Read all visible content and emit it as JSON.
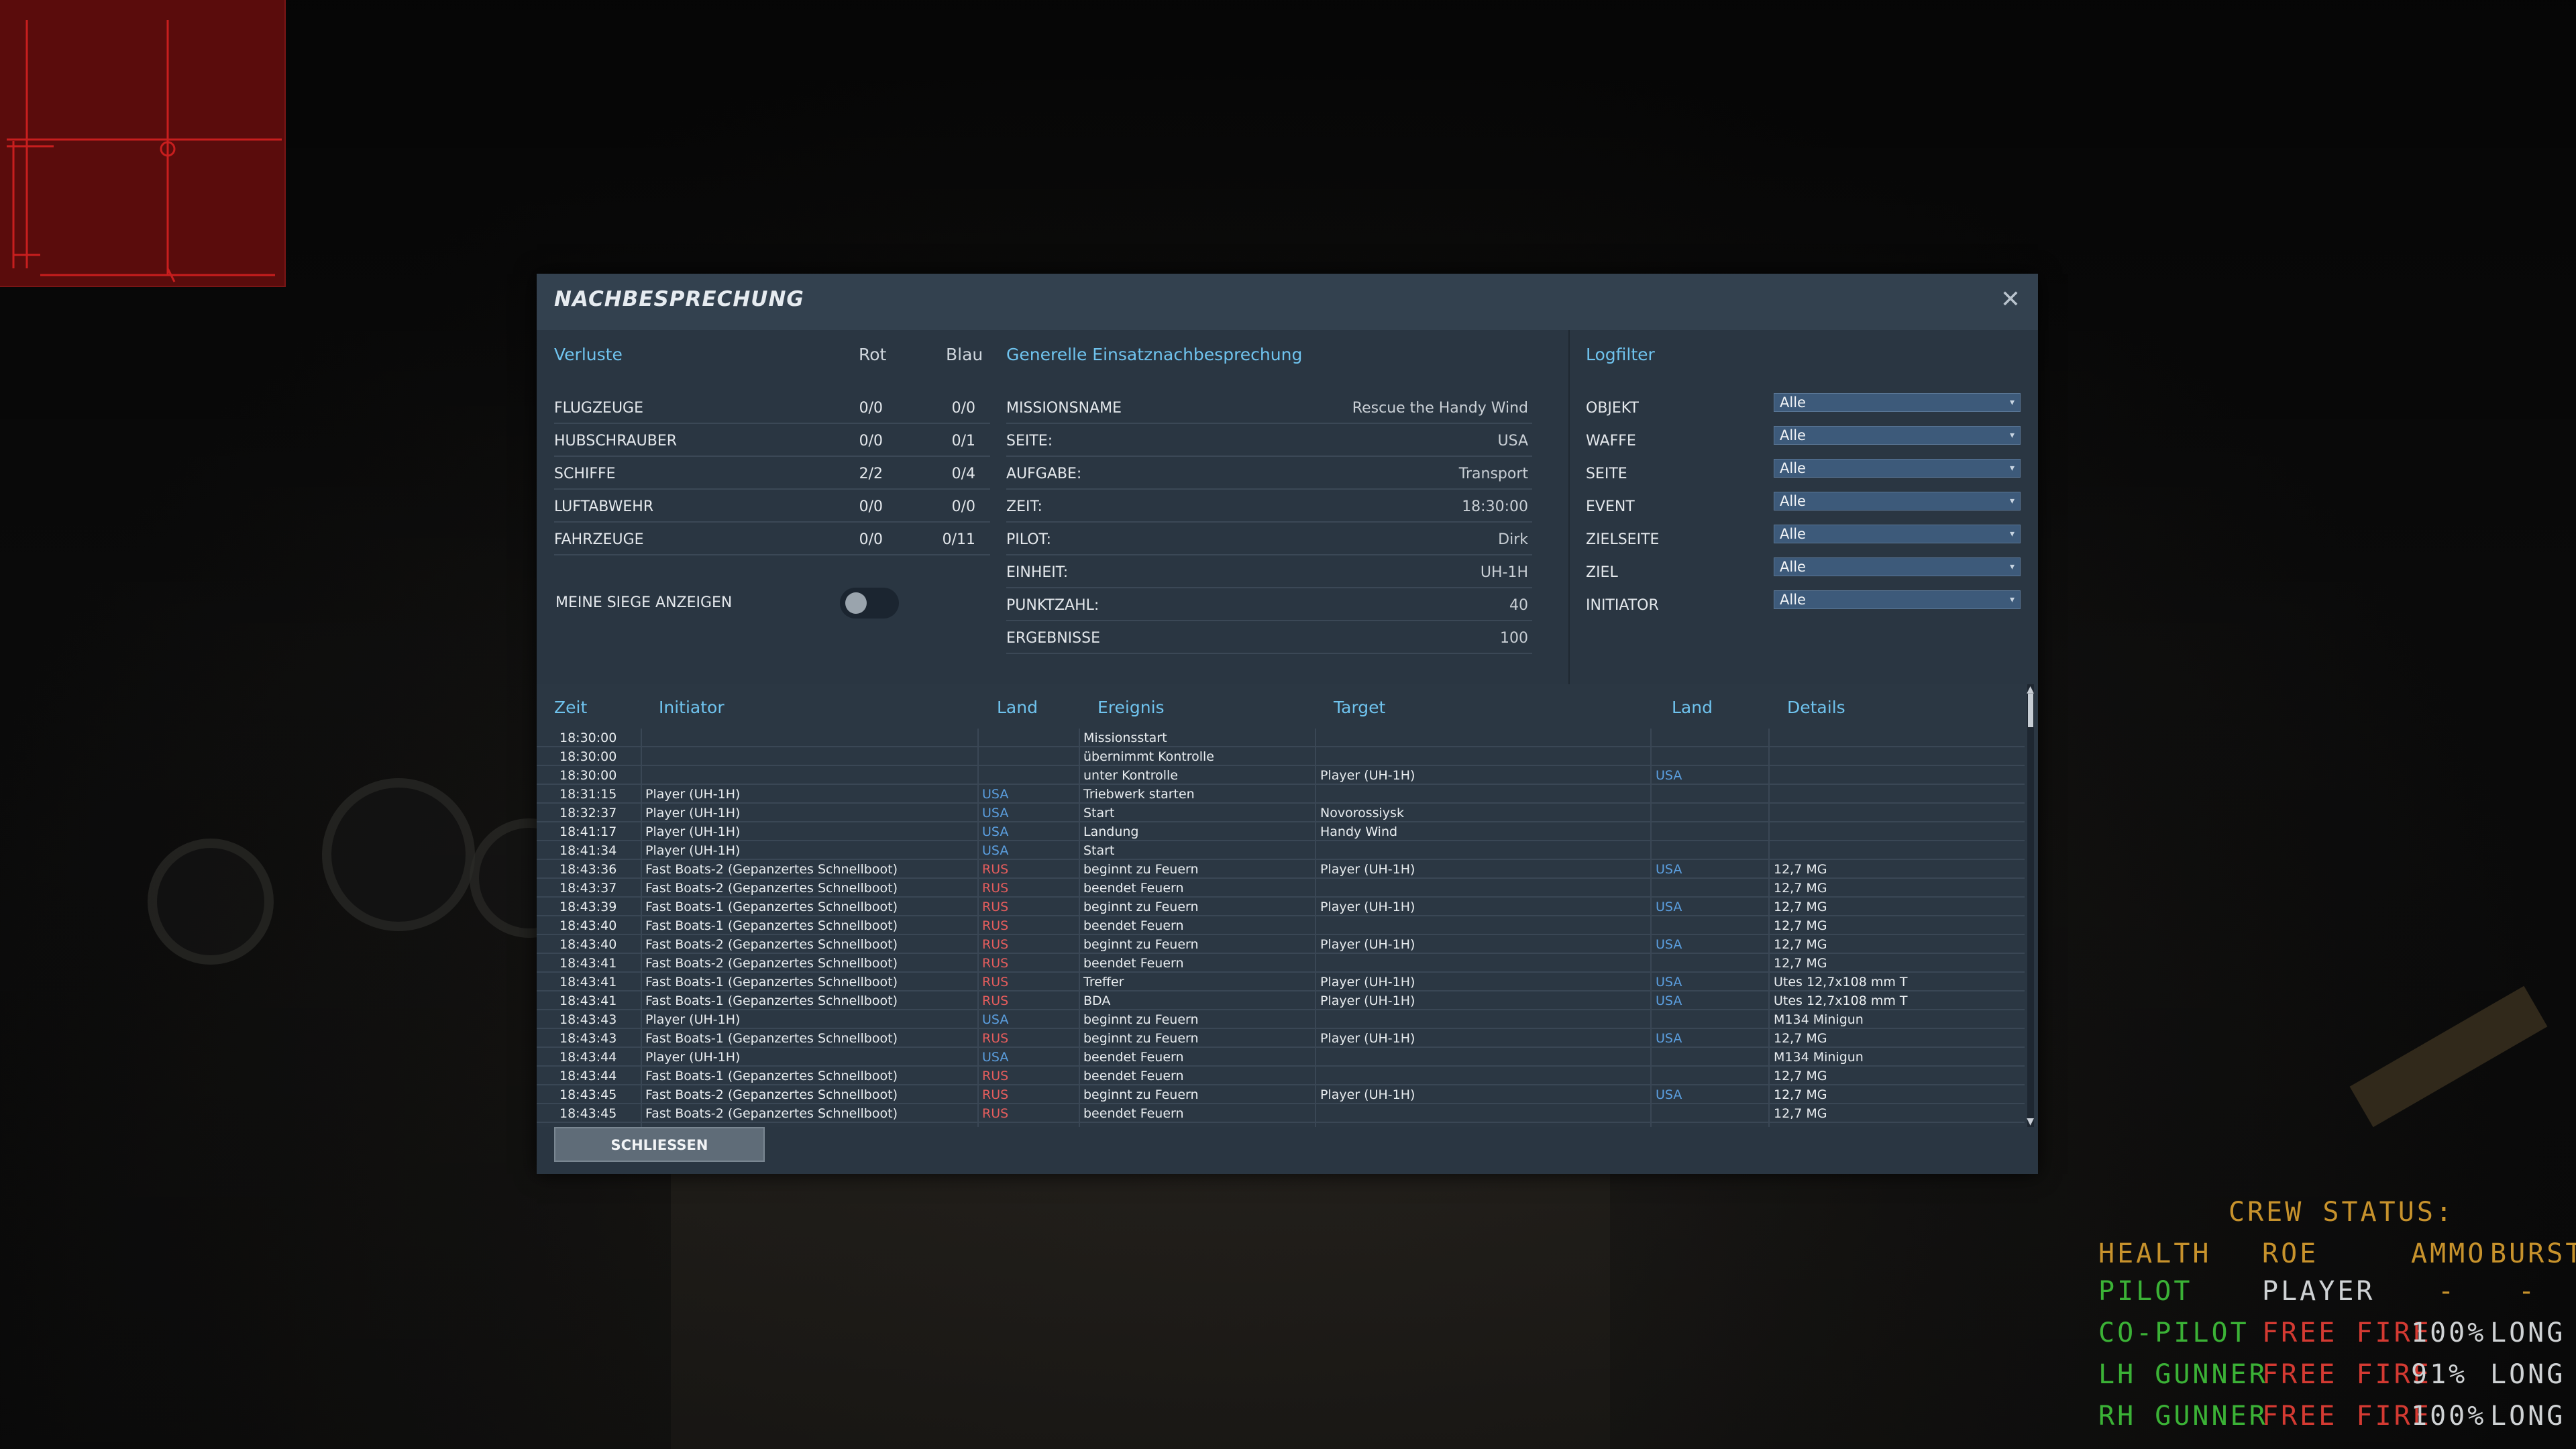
{
  "dialog": {
    "title": "NACHBESPRECHUNG",
    "close_icon": "close-icon",
    "close_button": "SCHLIESSEN"
  },
  "losses": {
    "header": "Verluste",
    "col_red": "Rot",
    "col_blue": "Blau",
    "rows": [
      {
        "label": "FLUGZEUGE",
        "red": "0/0",
        "blue": "0/0"
      },
      {
        "label": "HUBSCHRAUBER",
        "red": "0/0",
        "blue": "0/1"
      },
      {
        "label": "SCHIFFE",
        "red": "2/2",
        "blue": "0/4"
      },
      {
        "label": "LUFTABWEHR",
        "red": "0/0",
        "blue": "0/0"
      },
      {
        "label": "FAHRZEUGE",
        "red": "0/0",
        "blue": "0/11"
      }
    ],
    "toggle_label": "MEINE SIEGE ANZEIGEN",
    "toggle_on": false
  },
  "general": {
    "header": "Generelle Einsatznachbesprechung",
    "rows": [
      {
        "label": "MISSIONSNAME",
        "value": "Rescue the Handy Wind"
      },
      {
        "label": "SEITE:",
        "value": "USA"
      },
      {
        "label": "AUFGABE:",
        "value": "Transport"
      },
      {
        "label": "ZEIT:",
        "value": "18:30:00"
      },
      {
        "label": "PILOT:",
        "value": "Dirk"
      },
      {
        "label": "EINHEIT:",
        "value": "UH-1H"
      },
      {
        "label": "PUNKTZAHL:",
        "value": "40"
      },
      {
        "label": "ERGEBNISSE",
        "value": "100"
      }
    ]
  },
  "logfilter": {
    "header": "Logfilter",
    "rows": [
      {
        "label": "OBJEKT",
        "value": "Alle"
      },
      {
        "label": "WAFFE",
        "value": "Alle"
      },
      {
        "label": "SEITE",
        "value": "Alle"
      },
      {
        "label": "EVENT",
        "value": "Alle"
      },
      {
        "label": "ZIELSEITE",
        "value": "Alle"
      },
      {
        "label": "ZIEL",
        "value": "Alle"
      },
      {
        "label": "INITIATOR",
        "value": "Alle"
      }
    ]
  },
  "log": {
    "headers": {
      "time": "Zeit",
      "initiator": "Initiator",
      "land": "Land",
      "event": "Ereignis",
      "target": "Target",
      "land2": "Land",
      "details": "Details"
    },
    "rows": [
      {
        "time": "18:30:00",
        "initiator": "",
        "land": "",
        "event": "Missionsstart",
        "target": "",
        "land2": "",
        "details": ""
      },
      {
        "time": "18:30:00",
        "initiator": "",
        "land": "",
        "event": "übernimmt Kontrolle",
        "target": "",
        "land2": "",
        "details": ""
      },
      {
        "time": "18:30:00",
        "initiator": "",
        "land": "",
        "event": "unter Kontrolle",
        "target": "Player (UH-1H)",
        "land2": "USA",
        "details": ""
      },
      {
        "time": "18:31:15",
        "initiator": "Player (UH-1H)",
        "land": "USA",
        "event": "Triebwerk starten",
        "target": "",
        "land2": "",
        "details": ""
      },
      {
        "time": "18:32:37",
        "initiator": "Player (UH-1H)",
        "land": "USA",
        "event": "Start",
        "target": "Novorossiysk",
        "land2": "",
        "details": ""
      },
      {
        "time": "18:41:17",
        "initiator": "Player (UH-1H)",
        "land": "USA",
        "event": "Landung",
        "target": "Handy Wind",
        "land2": "",
        "details": ""
      },
      {
        "time": "18:41:34",
        "initiator": "Player (UH-1H)",
        "land": "USA",
        "event": "Start",
        "target": "",
        "land2": "",
        "details": ""
      },
      {
        "time": "18:43:36",
        "initiator": "Fast Boats-2 (Gepanzertes Schnellboot)",
        "land": "RUS",
        "event": "beginnt zu Feuern",
        "target": "Player (UH-1H)",
        "land2": "USA",
        "details": "12,7 MG"
      },
      {
        "time": "18:43:37",
        "initiator": "Fast Boats-2 (Gepanzertes Schnellboot)",
        "land": "RUS",
        "event": "beendet Feuern",
        "target": "",
        "land2": "",
        "details": "12,7 MG"
      },
      {
        "time": "18:43:39",
        "initiator": "Fast Boats-1 (Gepanzertes Schnellboot)",
        "land": "RUS",
        "event": "beginnt zu Feuern",
        "target": "Player (UH-1H)",
        "land2": "USA",
        "details": "12,7 MG"
      },
      {
        "time": "18:43:40",
        "initiator": "Fast Boats-1 (Gepanzertes Schnellboot)",
        "land": "RUS",
        "event": "beendet Feuern",
        "target": "",
        "land2": "",
        "details": "12,7 MG"
      },
      {
        "time": "18:43:40",
        "initiator": "Fast Boats-2 (Gepanzertes Schnellboot)",
        "land": "RUS",
        "event": "beginnt zu Feuern",
        "target": "Player (UH-1H)",
        "land2": "USA",
        "details": "12,7 MG"
      },
      {
        "time": "18:43:41",
        "initiator": "Fast Boats-2 (Gepanzertes Schnellboot)",
        "land": "RUS",
        "event": "beendet Feuern",
        "target": "",
        "land2": "",
        "details": "12,7 MG"
      },
      {
        "time": "18:43:41",
        "initiator": "Fast Boats-1 (Gepanzertes Schnellboot)",
        "land": "RUS",
        "event": "Treffer",
        "target": "Player (UH-1H)",
        "land2": "USA",
        "details": "Utes 12,7x108 mm T"
      },
      {
        "time": "18:43:41",
        "initiator": "Fast Boats-1 (Gepanzertes Schnellboot)",
        "land": "RUS",
        "event": "BDA",
        "target": "Player (UH-1H)",
        "land2": "USA",
        "details": "Utes 12,7x108 mm T"
      },
      {
        "time": "18:43:43",
        "initiator": "Player (UH-1H)",
        "land": "USA",
        "event": "beginnt zu Feuern",
        "target": "",
        "land2": "",
        "details": "M134 Minigun"
      },
      {
        "time": "18:43:43",
        "initiator": "Fast Boats-1 (Gepanzertes Schnellboot)",
        "land": "RUS",
        "event": "beginnt zu Feuern",
        "target": "Player (UH-1H)",
        "land2": "USA",
        "details": "12,7 MG"
      },
      {
        "time": "18:43:44",
        "initiator": "Player (UH-1H)",
        "land": "USA",
        "event": "beendet Feuern",
        "target": "",
        "land2": "",
        "details": "M134 Minigun"
      },
      {
        "time": "18:43:44",
        "initiator": "Fast Boats-1 (Gepanzertes Schnellboot)",
        "land": "RUS",
        "event": "beendet Feuern",
        "target": "",
        "land2": "",
        "details": "12,7 MG"
      },
      {
        "time": "18:43:45",
        "initiator": "Fast Boats-2 (Gepanzertes Schnellboot)",
        "land": "RUS",
        "event": "beginnt zu Feuern",
        "target": "Player (UH-1H)",
        "land2": "USA",
        "details": "12,7 MG"
      },
      {
        "time": "18:43:45",
        "initiator": "Fast Boats-2 (Gepanzertes Schnellboot)",
        "land": "RUS",
        "event": "beendet Feuern",
        "target": "",
        "land2": "",
        "details": "12,7 MG"
      }
    ]
  },
  "crew": {
    "title": "CREW STATUS:",
    "headers": {
      "health": "HEALTH",
      "roe": "ROE",
      "ammo": "AMMO",
      "burst": "BURST"
    },
    "rows": [
      {
        "name": "PILOT",
        "roe": "PLAYER",
        "ammo": "-",
        "burst": "-"
      },
      {
        "name": "CO-PILOT",
        "roe": "FREE FIRE",
        "ammo": "100%",
        "burst": "LONG"
      },
      {
        "name": "LH GUNNER",
        "roe": "FREE FIRE",
        "ammo": "91%",
        "burst": "LONG"
      },
      {
        "name": "RH GUNNER",
        "roe": "FREE FIRE",
        "ammo": "100%",
        "burst": "LONG"
      }
    ]
  },
  "colors": {
    "accent": "#6fc3ee",
    "usa": "#5b9fe0",
    "rus": "#e55d5d",
    "crew_amber": "#c7922c",
    "crew_green": "#3bb236",
    "crew_red": "#d43a32"
  }
}
